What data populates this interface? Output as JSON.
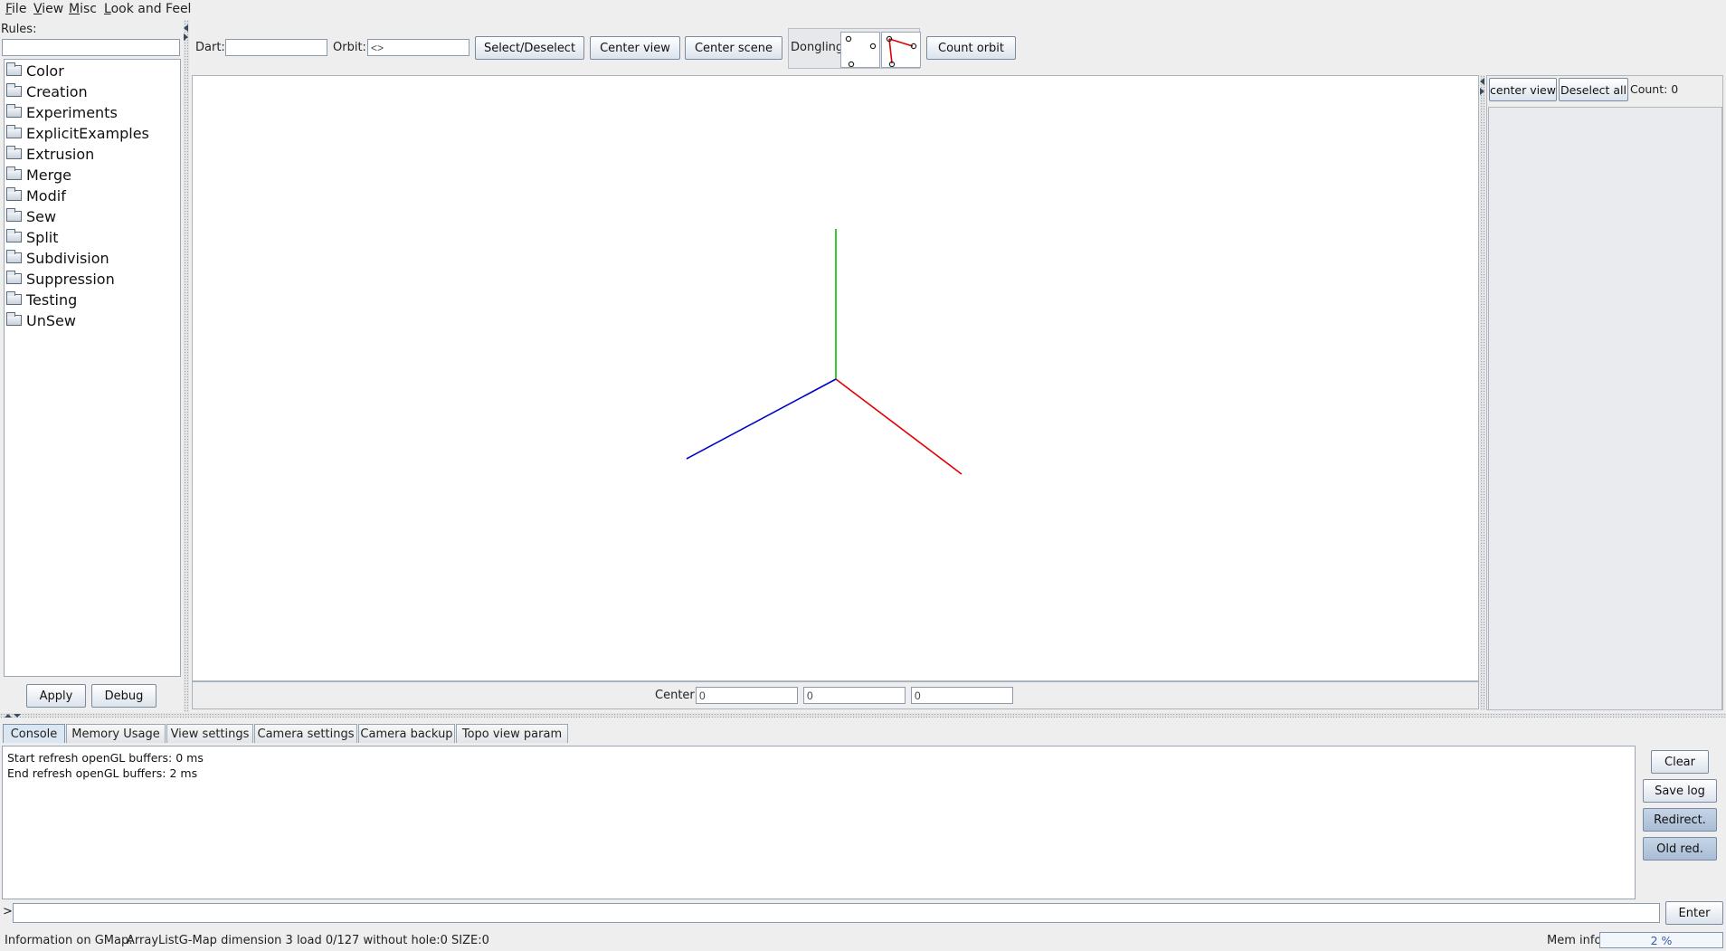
{
  "menu": {
    "file": {
      "mnemonic": "F",
      "rest": "ile"
    },
    "view": {
      "mnemonic": "V",
      "rest": "iew"
    },
    "misc": {
      "mnemonic": "M",
      "rest": "isc"
    },
    "look_and_feel": {
      "mnemonic": "L",
      "rest": "ook and Feel"
    }
  },
  "rules_panel": {
    "label": "Rules:",
    "filter_value": "",
    "items": [
      "Color",
      "Creation",
      "Experiments",
      "ExplicitExamples",
      "Extrusion",
      "Merge",
      "Modif",
      "Sew",
      "Split",
      "Subdivision",
      "Suppression",
      "Testing",
      "UnSew"
    ],
    "apply_label": "Apply",
    "debug_label": "Debug"
  },
  "toolbar": {
    "dart_label": "Dart:",
    "dart_value": "",
    "orbit_label": "Orbit:",
    "orbit_value": "<>",
    "select_deselect_label": "Select/Deselect",
    "center_view_label": "Center view",
    "center_scene_label": "Center scene",
    "dongling_label": "Dongling:",
    "count_orbit_label": "Count orbit"
  },
  "viewport": {
    "axes": [
      {
        "name": "y-axis",
        "color": "#00c000"
      },
      {
        "name": "x-axis",
        "color": "#e00000"
      },
      {
        "name": "z-axis",
        "color": "#0000c8"
      }
    ]
  },
  "center_bar": {
    "label": "Center:",
    "x": "0",
    "y": "0",
    "z": "0"
  },
  "right_panel": {
    "center_view_label": "center view",
    "deselect_all_label": "Deselect all",
    "count_label": "Count: 0"
  },
  "bottom_tabs": {
    "tabs": [
      "Console",
      "Memory Usage",
      "View settings",
      "Camera settings",
      "Camera backup",
      "Topo view param"
    ],
    "active": "Console"
  },
  "console": {
    "lines": [
      "Start refresh openGL buffers: 0 ms",
      "End refresh openGL buffers: 2 ms"
    ],
    "clear_label": "Clear",
    "save_log_label": "Save log",
    "redirect_label": "Redirect.",
    "old_red_label": "Old red.",
    "prompt": ">",
    "command_value": "",
    "enter_label": "Enter"
  },
  "status": {
    "info_label": "Information on GMap:",
    "info_value": "ArrayListG-Map dimension 3 load 0/127 without hole:0 SIZE:0",
    "mem_label": "Mem info:",
    "mem_value": "2 %"
  }
}
